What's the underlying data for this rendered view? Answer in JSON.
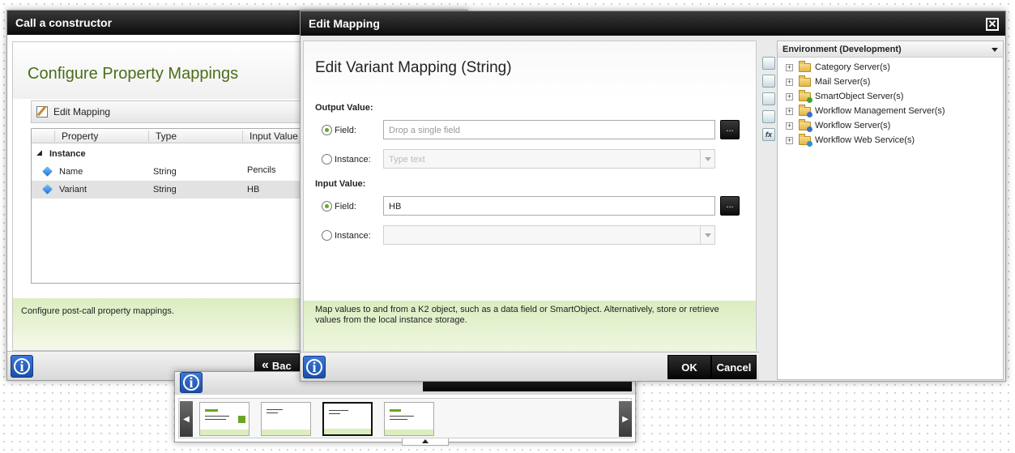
{
  "wizard": {
    "title": "Call a constructor",
    "heading": "Configure Property Mappings",
    "toolbar_label": "Edit Mapping",
    "columns": [
      "Property",
      "Type",
      "Input Value"
    ],
    "group": "Instance",
    "rows": [
      {
        "property": "Name",
        "type": "String",
        "value": "Pencils"
      },
      {
        "property": "Variant",
        "type": "String",
        "value": "HB"
      }
    ],
    "help_text": "Configure post-call property mappings.",
    "back_label": "Bac"
  },
  "dialog": {
    "title": "Edit Mapping",
    "heading": "Edit Variant Mapping (String)",
    "output_section": "Output Value:",
    "input_section": "Input Value:",
    "field_label": "Field:",
    "instance_label": "Instance:",
    "output_field_placeholder": "Drop a single field",
    "output_instance_placeholder": "Type text",
    "input_field_value": "HB",
    "browse_label": "...",
    "help_line1": "Map values to and from a K2 object, such as a data field or SmartObject. Alternatively, store or retrieve",
    "help_line2": "values from the local instance storage.",
    "ok_label": "OK",
    "cancel_label": "Cancel",
    "close_glyph": "✕",
    "info_glyph": "i"
  },
  "explorer": {
    "title": "Environment (Development)",
    "nodes": [
      {
        "label": "Category Server(s)",
        "icon": "folder-icon"
      },
      {
        "label": "Mail Server(s)",
        "icon": "folder-icon"
      },
      {
        "label": "SmartObject Server(s)",
        "icon": "folder-icon"
      },
      {
        "label": "Workflow Management Server(s)",
        "icon": "folder-icon"
      },
      {
        "label": "Workflow Server(s)",
        "icon": "folder-icon"
      },
      {
        "label": "Workflow Web Service(s)",
        "icon": "folder-icon"
      }
    ]
  },
  "colors": {
    "accent_green": "#4a6e18",
    "help_green": "#dcedc0",
    "info_blue": "#2a62c2"
  }
}
